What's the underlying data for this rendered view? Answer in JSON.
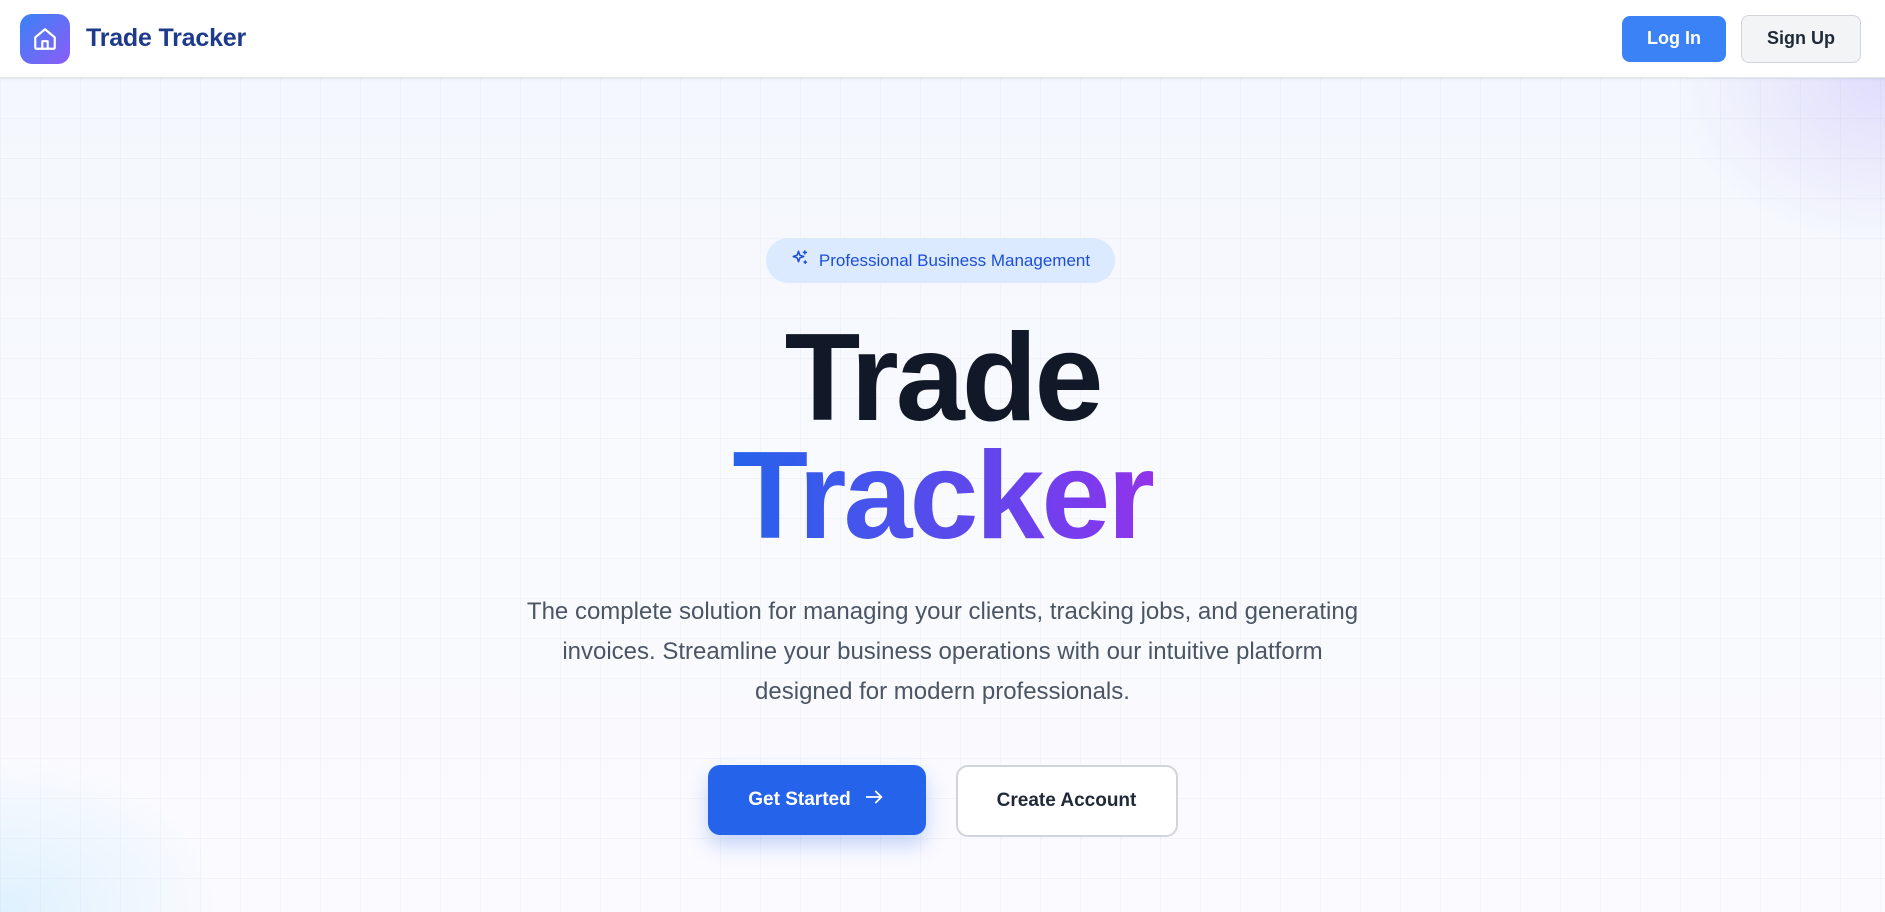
{
  "header": {
    "brand_name": "Trade Tracker",
    "logo_icon": "home-icon",
    "login_label": "Log In",
    "signup_label": "Sign Up"
  },
  "hero": {
    "badge_icon": "sparkles-icon",
    "badge_text": "Professional Business Management",
    "title_line1": "Trade",
    "title_line2": "Tracker",
    "subtitle": "The complete solution for managing your clients, tracking jobs, and generating invoices. Streamline your business operations with our intuitive platform designed for modern professionals.",
    "primary_cta": "Get Started",
    "primary_cta_icon": "arrow-right-icon",
    "secondary_cta": "Create Account"
  },
  "colors": {
    "accent": "#3b82f6",
    "primary_button": "#2563eb",
    "gradient_start": "#2563eb",
    "gradient_end": "#9333ea",
    "brand_text": "#1e3a8a"
  }
}
